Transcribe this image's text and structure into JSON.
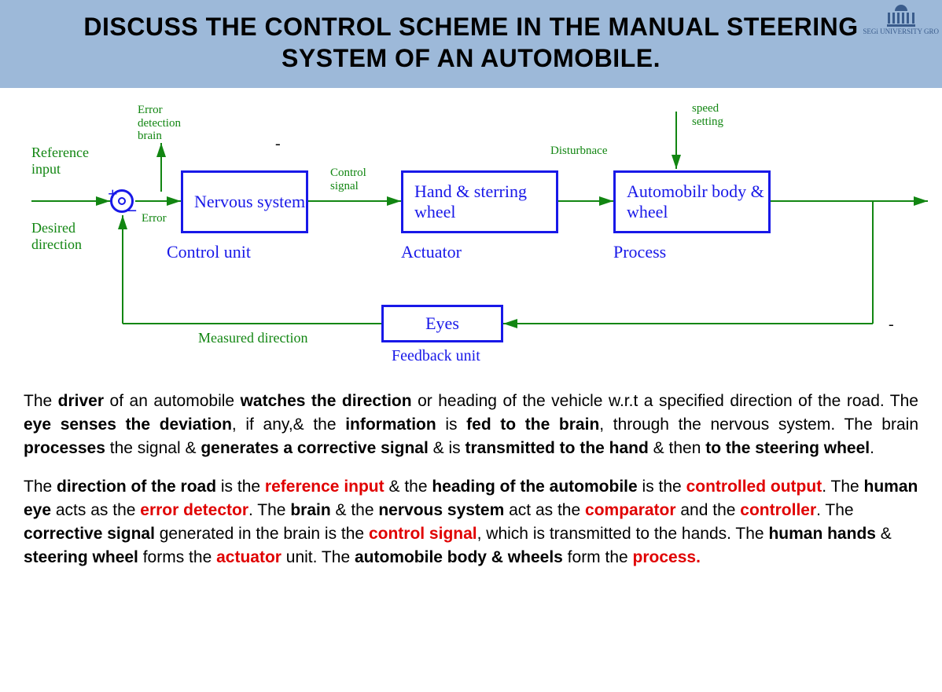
{
  "header": {
    "title": "DISCUSS THE CONTROL SCHEME IN THE MANUAL STEERING SYSTEM OF AN AUTOMOBILE.",
    "logo_text": "SEGi UNIVERSITY GRO"
  },
  "diagram": {
    "blocks": {
      "control_unit_box": "Nervous system",
      "control_unit_label": "Control unit",
      "actuator_box": "Hand & sterring wheel",
      "actuator_label": "Actuator",
      "process_box": "Automobilr body & wheel",
      "process_label": "Process",
      "feedback_box": "Eyes",
      "feedback_label": "Feedback unit"
    },
    "annotations": {
      "reference_input": "Reference input",
      "desired_direction": "Desired direction",
      "error_detection_brain": "Error detection brain",
      "error": "Error",
      "control_signal": "Control signal",
      "disturbance": "Disturbnace",
      "speed_setting": "speed setting",
      "measured_direction": "Measured direction",
      "plus": "+",
      "minus": "_",
      "dash1": "-",
      "dash2": "-"
    }
  },
  "body": {
    "p1_parts": [
      {
        "t": "The "
      },
      {
        "t": "driver",
        "b": true
      },
      {
        "t": " of an automobile "
      },
      {
        "t": "watches the direction",
        "b": true
      },
      {
        "t": " or heading of the vehicle w.r.t a specified direction of the road. The "
      },
      {
        "t": "eye senses the deviation",
        "b": true
      },
      {
        "t": ", if any,& the "
      },
      {
        "t": "information",
        "b": true
      },
      {
        "t": " is "
      },
      {
        "t": "fed to the brain",
        "b": true
      },
      {
        "t": ", through the nervous system. The brain "
      },
      {
        "t": "processes",
        "b": true
      },
      {
        "t": " the signal & "
      },
      {
        "t": "generates a corrective signal",
        "b": true
      },
      {
        "t": " & is "
      },
      {
        "t": "transmitted to the hand",
        "b": true
      },
      {
        "t": " & then "
      },
      {
        "t": "to the steering wheel",
        "b": true
      },
      {
        "t": "."
      }
    ],
    "p2_parts": [
      {
        "t": "The "
      },
      {
        "t": "direction of the road",
        "b": true
      },
      {
        "t": " is the "
      },
      {
        "t": "reference input",
        "r": true
      },
      {
        "t": " & the "
      },
      {
        "t": "heading of the automobile",
        "b": true
      },
      {
        "t": " is the "
      },
      {
        "t": "controlled output",
        "r": true
      },
      {
        "t": ". The "
      },
      {
        "t": "human eye",
        "b": true
      },
      {
        "t": " acts as the "
      },
      {
        "t": "error detector",
        "r": true
      },
      {
        "t": ". The "
      },
      {
        "t": "brain",
        "b": true
      },
      {
        "t": " & the "
      },
      {
        "t": "nervous system",
        "b": true
      },
      {
        "t": " act as the "
      },
      {
        "t": "comparator",
        "r": true
      },
      {
        "t": " and the "
      },
      {
        "t": "controller",
        "r": true
      },
      {
        "t": ". The "
      },
      {
        "t": "corrective signal",
        "b": true
      },
      {
        "t": " generated in the brain is the "
      },
      {
        "t": "control signal",
        "r": true
      },
      {
        "t": ", which is transmitted to the hands. The "
      },
      {
        "t": "human hands",
        "b": true
      },
      {
        "t": " & "
      },
      {
        "t": "steering wheel",
        "b": true
      },
      {
        "t": " forms the "
      },
      {
        "t": "actuator",
        "r": true
      },
      {
        "t": " unit. The "
      },
      {
        "t": "automobile body & wheels",
        "b": true
      },
      {
        "t": " form the "
      },
      {
        "t": "process.",
        "r": true
      }
    ]
  }
}
